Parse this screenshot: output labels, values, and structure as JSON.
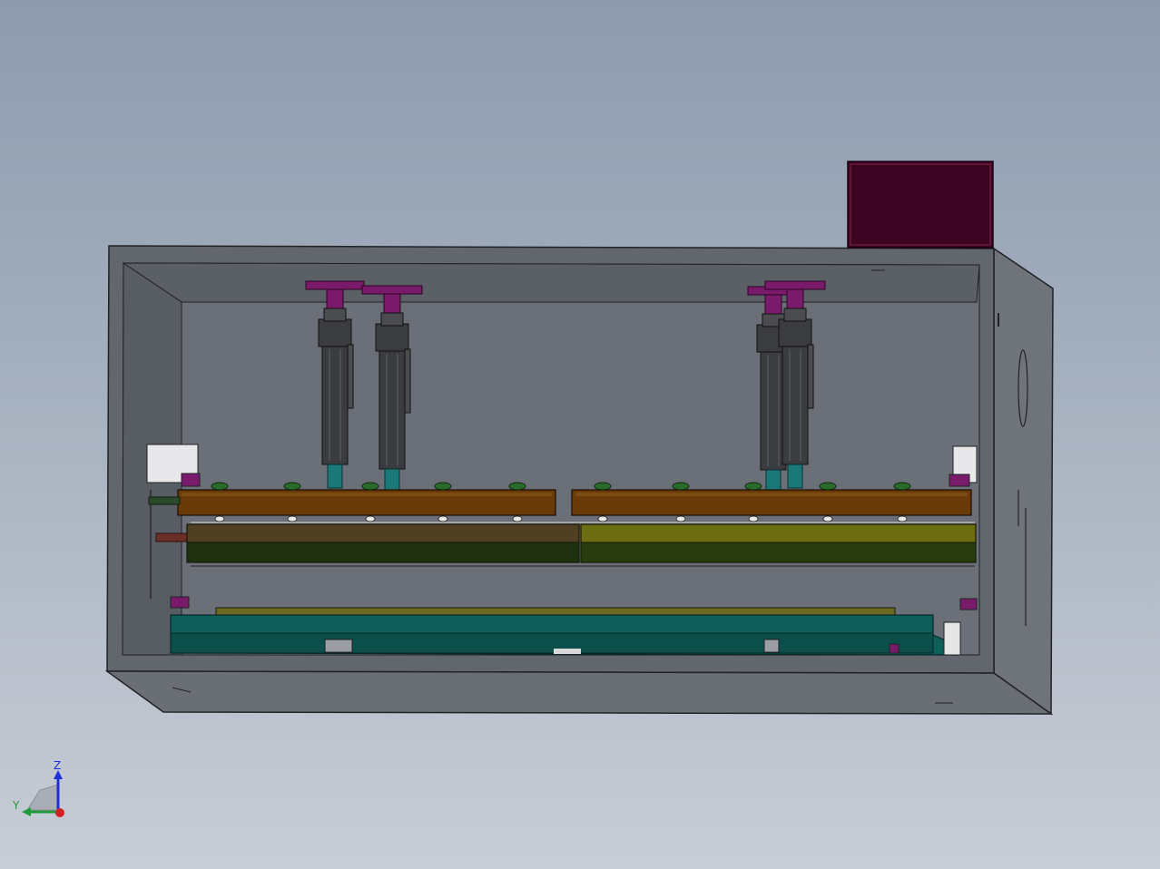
{
  "viewport": {
    "background_top": "#8d9bae",
    "background_bottom": "#c8cdd6"
  },
  "triad": {
    "x_label": "",
    "y_label": "Y",
    "z_label": "Z",
    "y_color": "#1f9a3a",
    "z_color": "#1f2fd6",
    "x_color": "#d02020"
  },
  "model": {
    "frame_color": "#5c6068",
    "control_box_color": "#3c0420",
    "cylinder_color": "#3a3c40",
    "rod_color": "#1b7878",
    "mount_color": "#7a1a6a",
    "upper_bar_color": "#6a3a08",
    "lower_bar_left_color": "#4e4020",
    "lower_bar_right_color": "#6c6c10",
    "base_plate_color": "#0e5e5a"
  }
}
